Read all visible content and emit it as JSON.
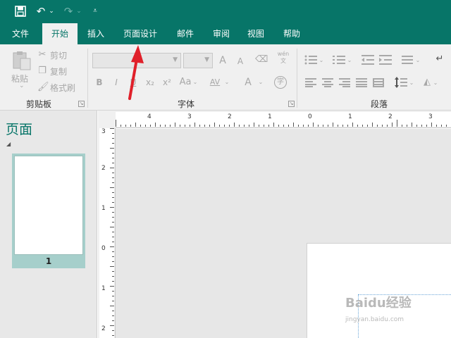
{
  "quick_access": {
    "save_icon": "save-icon",
    "undo_icon": "undo-icon",
    "redo_icon": "redo-icon",
    "customize_icon": "customize-qat-icon"
  },
  "tabs": [
    {
      "label": "文件"
    },
    {
      "label": "开始"
    },
    {
      "label": "插入"
    },
    {
      "label": "页面设计"
    },
    {
      "label": "邮件"
    },
    {
      "label": "审阅"
    },
    {
      "label": "视图"
    },
    {
      "label": "帮助"
    }
  ],
  "active_tab": "开始",
  "ribbon": {
    "clipboard": {
      "label": "剪贴板",
      "paste": "粘贴",
      "cut": "剪切",
      "copy": "复制",
      "format_painter": "格式刷"
    },
    "font": {
      "label": "字体",
      "font_name_value": "",
      "font_size_value": "",
      "pinyin_icon_text": "wén\n文",
      "bold": "B",
      "italic": "I",
      "subscript": "x₂",
      "superscript": "x²",
      "change_case": "Aa",
      "char_spacing": "AV",
      "font_color": "A",
      "enclose_char": "字",
      "grow_font": "A",
      "shrink_font": "A"
    },
    "paragraph": {
      "label": "段落"
    }
  },
  "page_pane": {
    "title": "页面",
    "page_number": "1"
  },
  "rulers": {
    "horizontal_labels": [
      "4",
      "3",
      "2",
      "1",
      "0",
      "1",
      "2",
      "3"
    ],
    "vertical_labels": [
      "3",
      "2",
      "1",
      "0",
      "1",
      "2"
    ]
  },
  "watermark": {
    "brand": "Baidu经验",
    "url": "jingyan.baidu.com"
  },
  "colors": {
    "title_bar": "#077568",
    "annotation_arrow": "#e0202a"
  }
}
